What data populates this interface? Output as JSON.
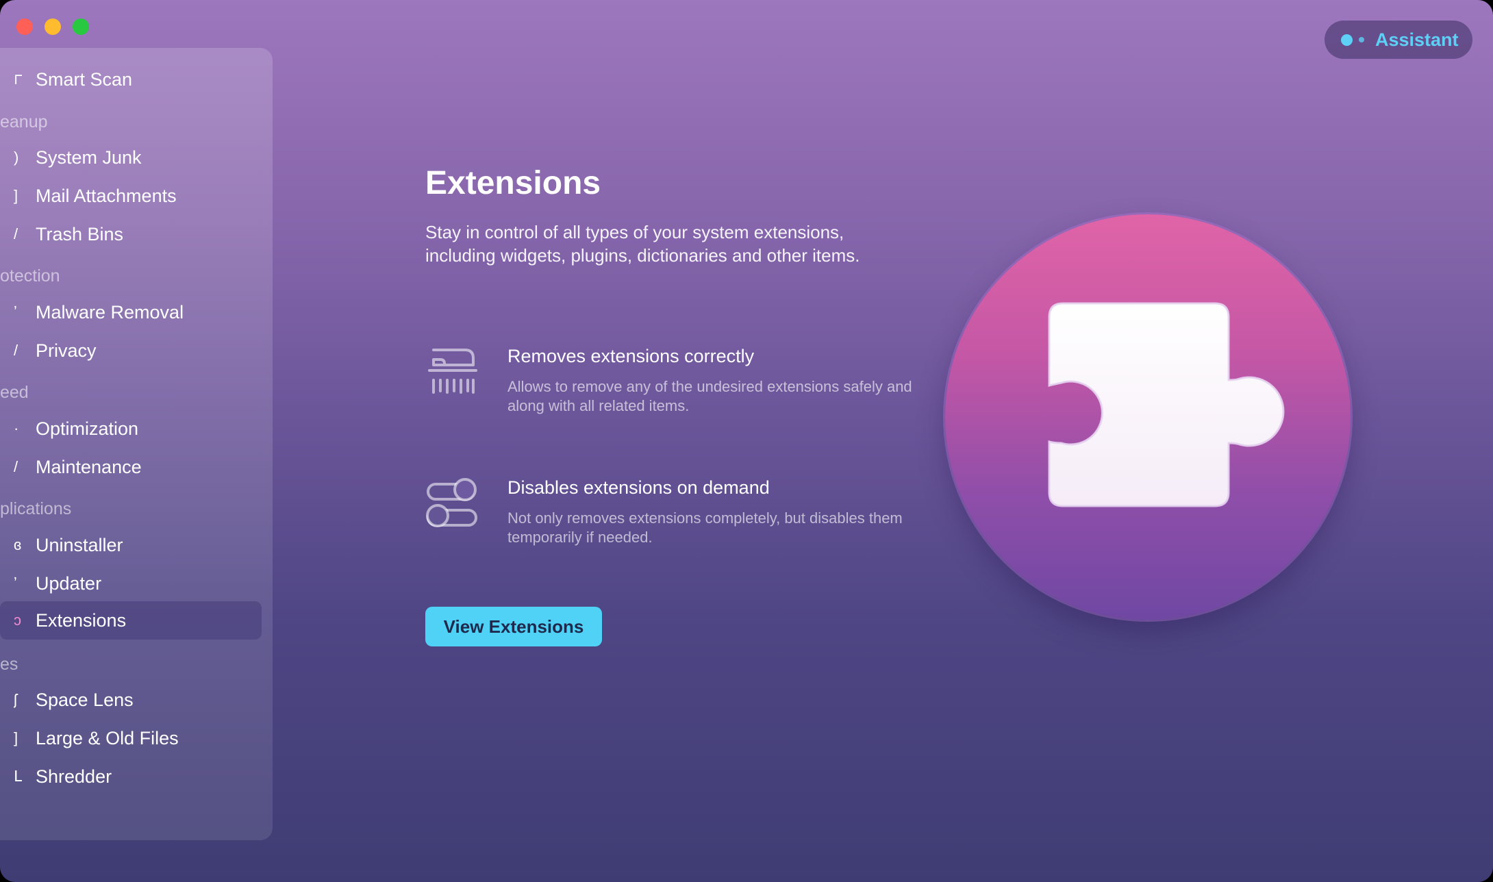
{
  "sidebar": {
    "items": [
      {
        "label": "Smart Scan",
        "icon": "smart-scan-icon"
      },
      {
        "section": "eanup"
      },
      {
        "label": "System Junk",
        "icon": "system-junk-icon"
      },
      {
        "label": "Mail Attachments",
        "icon": "mail-attachments-icon"
      },
      {
        "label": "Trash Bins",
        "icon": "trash-bins-icon"
      },
      {
        "section": "otection"
      },
      {
        "label": "Malware Removal",
        "icon": "malware-removal-icon"
      },
      {
        "label": "Privacy",
        "icon": "privacy-icon"
      },
      {
        "section": "eed"
      },
      {
        "label": "Optimization",
        "icon": "optimization-icon"
      },
      {
        "label": "Maintenance",
        "icon": "maintenance-icon"
      },
      {
        "section": "plications"
      },
      {
        "label": "Uninstaller",
        "icon": "uninstaller-icon"
      },
      {
        "label": "Updater",
        "icon": "updater-icon"
      },
      {
        "label": "Extensions",
        "icon": "extensions-icon",
        "active": true
      },
      {
        "section": "es"
      },
      {
        "label": "Space Lens",
        "icon": "space-lens-icon"
      },
      {
        "label": "Large & Old Files",
        "icon": "large-old-files-icon"
      },
      {
        "label": "Shredder",
        "icon": "shredder-icon"
      }
    ]
  },
  "assistant": {
    "label": "Assistant"
  },
  "main": {
    "title": "Extensions",
    "description": "Stay in control of all types of your system extensions, including widgets, plugins, dictionaries and other items.",
    "features": [
      {
        "heading": "Removes extensions correctly",
        "text": "Allows to remove any of the undesired extensions safely and along with all related items.",
        "icon": "shredder-icon"
      },
      {
        "heading": "Disables extensions on demand",
        "text": "Not only removes extensions completely, but disables them temporarily if needed.",
        "icon": "toggle-switches-icon"
      }
    ],
    "button_label": "View Extensions"
  },
  "colors": {
    "accent": "#4fd2f6",
    "assistant_text": "#5ed0f5",
    "hero_top": "#e064a7",
    "hero_bottom": "#6f48a3"
  }
}
